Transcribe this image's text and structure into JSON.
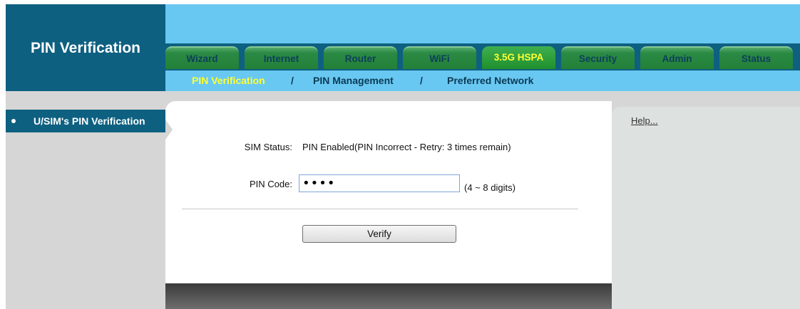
{
  "header": {
    "title": "PIN Verification",
    "tabs": [
      {
        "label": "Wizard"
      },
      {
        "label": "Internet"
      },
      {
        "label": "Router"
      },
      {
        "label": "WiFi"
      },
      {
        "label": "3.5G HSPA"
      },
      {
        "label": "Security"
      },
      {
        "label": "Admin"
      },
      {
        "label": "Status"
      }
    ],
    "active_tab": "3.5G HSPA"
  },
  "subnav": {
    "items": [
      "PIN Verification",
      "PIN Management",
      "Preferred Network"
    ],
    "separator": "/",
    "current": "PIN Verification"
  },
  "sidebar": {
    "items": [
      {
        "label": "U/SIM's PIN Verification"
      }
    ]
  },
  "form": {
    "sim_status_label": "SIM Status:",
    "sim_status_value": "PIN Enabled(PIN Incorrect - Retry: 3 times remain)",
    "pin_label": "PIN Code:",
    "pin_value": "••••",
    "pin_hint": "(4 ~ 8 digits)",
    "verify_label": "Verify"
  },
  "help": {
    "link": "Help..."
  },
  "colors": {
    "header_dark": "#0e6081",
    "header_light": "#69c8f2",
    "tab_green": "#238038",
    "active_text": "#ffff33",
    "band_gray": "#d6d6d6"
  }
}
